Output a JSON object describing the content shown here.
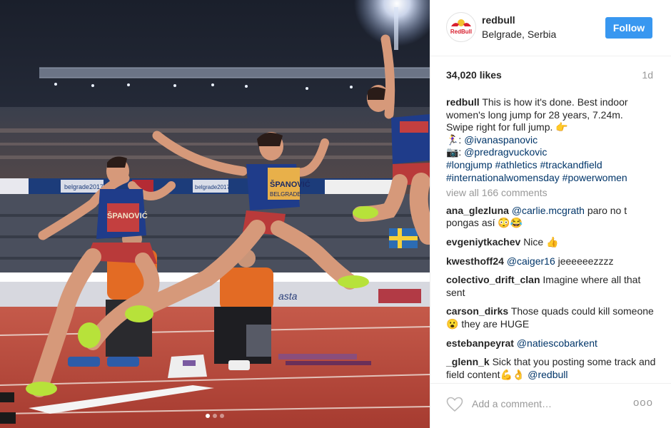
{
  "post": {
    "username": "redbull",
    "location": "Belgrade, Serbia",
    "follow_label": "Follow",
    "likes": "34,020 likes",
    "age": "1d",
    "avatar_text": "RedBull",
    "caption": {
      "user": "redbull",
      "line1": "This is how it's done. Best indoor",
      "line2": "women's long jump for 28 years, 7.24m.",
      "line3": "Swipe right for full jump. 👉",
      "line4_prefix": "🏃‍♀️: ",
      "line4_tag": "@ivanaspanovic",
      "line5_prefix": "📷: ",
      "line5_tag": "@predragvuckovic",
      "line6": "#longjump #athletics #trackandfield",
      "line7": "#internationalwomensday #powerwomen"
    },
    "view_all": "view all 166 comments"
  },
  "comments": [
    {
      "user": "ana_glezluna",
      "tag": "@carlie.mcgrath",
      "text": " paro no t pongas así 😳😂"
    },
    {
      "user": "evgeniytkachev",
      "tag": "",
      "text": "Nice 👍"
    },
    {
      "user": "kwesthoff24",
      "tag": "@caiger16",
      "text": " jeeeeeezzzz"
    },
    {
      "user": "colectivo_drift_clan",
      "tag": "",
      "text": "Imagine where all that sent"
    },
    {
      "user": "carson_dirks",
      "tag": "",
      "text": "Those quads could kill someone 😮 they are HUGE"
    },
    {
      "user": "estebanpeyrat",
      "tag": "@natiescobarkent",
      "text": ""
    },
    {
      "user": "_glenn_k",
      "tag": "",
      "text": "Sick that you posting some track and field content💪👌 ",
      "tag_after": "@redbull"
    }
  ],
  "footer": {
    "add_comment_placeholder": "Add a comment…",
    "more": "ooo"
  },
  "photo": {
    "sign_left": "belgrade2017",
    "sign_right": "belgrade2017",
    "bib_1": "ŠPANOVIĆ",
    "bib_2": "ŠPANOVIĆ",
    "bib_3": "BELGRADE",
    "board_text": "asta",
    "carousel_dots": 3,
    "active_dot": 1
  },
  "colors": {
    "accent": "#3897f0",
    "link": "#003569",
    "muted": "#999999",
    "track": "#b8473c"
  }
}
